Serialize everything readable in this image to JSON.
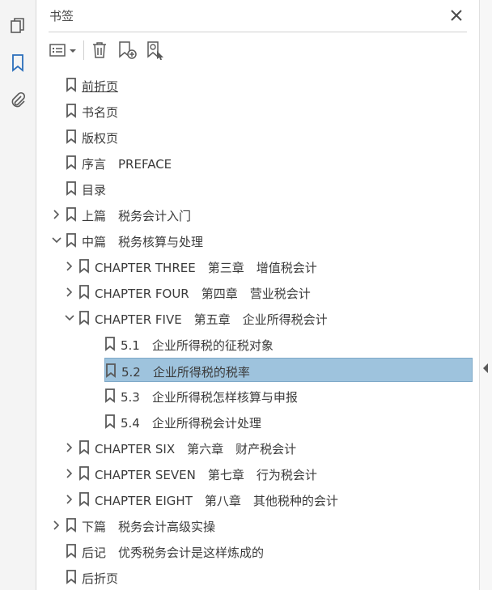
{
  "panel": {
    "title": "书签"
  },
  "tree": [
    {
      "label": "前折页",
      "level": 0,
      "expand": "none",
      "underline": true
    },
    {
      "label": "书名页",
      "level": 0,
      "expand": "none"
    },
    {
      "label": "版权页",
      "level": 0,
      "expand": "none"
    },
    {
      "label": "序言　PREFACE",
      "level": 0,
      "expand": "none"
    },
    {
      "label": "目录",
      "level": 0,
      "expand": "none"
    },
    {
      "label": "上篇　税务会计入门",
      "level": 0,
      "expand": "collapsed"
    },
    {
      "label": "中篇　税务核算与处理",
      "level": 0,
      "expand": "expanded"
    },
    {
      "label": "CHAPTER THREE　第三章　增值税会计",
      "level": 1,
      "expand": "collapsed"
    },
    {
      "label": "CHAPTER FOUR　第四章　营业税会计",
      "level": 1,
      "expand": "collapsed"
    },
    {
      "label": "CHAPTER FIVE　第五章　企业所得税会计",
      "level": 1,
      "expand": "expanded"
    },
    {
      "label": "5.1　企业所得税的征税对象",
      "level": 2,
      "expand": "none"
    },
    {
      "label": "5.2　企业所得税的税率",
      "level": 2,
      "expand": "none",
      "selected": true
    },
    {
      "label": "5.3　企业所得税怎样核算与申报",
      "level": 2,
      "expand": "none"
    },
    {
      "label": "5.4　企业所得税会计处理",
      "level": 2,
      "expand": "none"
    },
    {
      "label": "CHAPTER SIX　第六章　财产税会计",
      "level": 1,
      "expand": "collapsed"
    },
    {
      "label": "CHAPTER SEVEN　第七章　行为税会计",
      "level": 1,
      "expand": "collapsed"
    },
    {
      "label": "CHAPTER EIGHT　第八章　其他税种的会计",
      "level": 1,
      "expand": "collapsed"
    },
    {
      "label": "下篇　税务会计高级实操",
      "level": 0,
      "expand": "collapsed"
    },
    {
      "label": "后记　优秀税务会计是这样炼成的",
      "level": 0,
      "expand": "none"
    },
    {
      "label": "后折页",
      "level": 0,
      "expand": "none"
    }
  ],
  "colors": {
    "accent": "#2a6ebb",
    "selection": "#9ec3dd",
    "icon": "#5a5a5a"
  }
}
